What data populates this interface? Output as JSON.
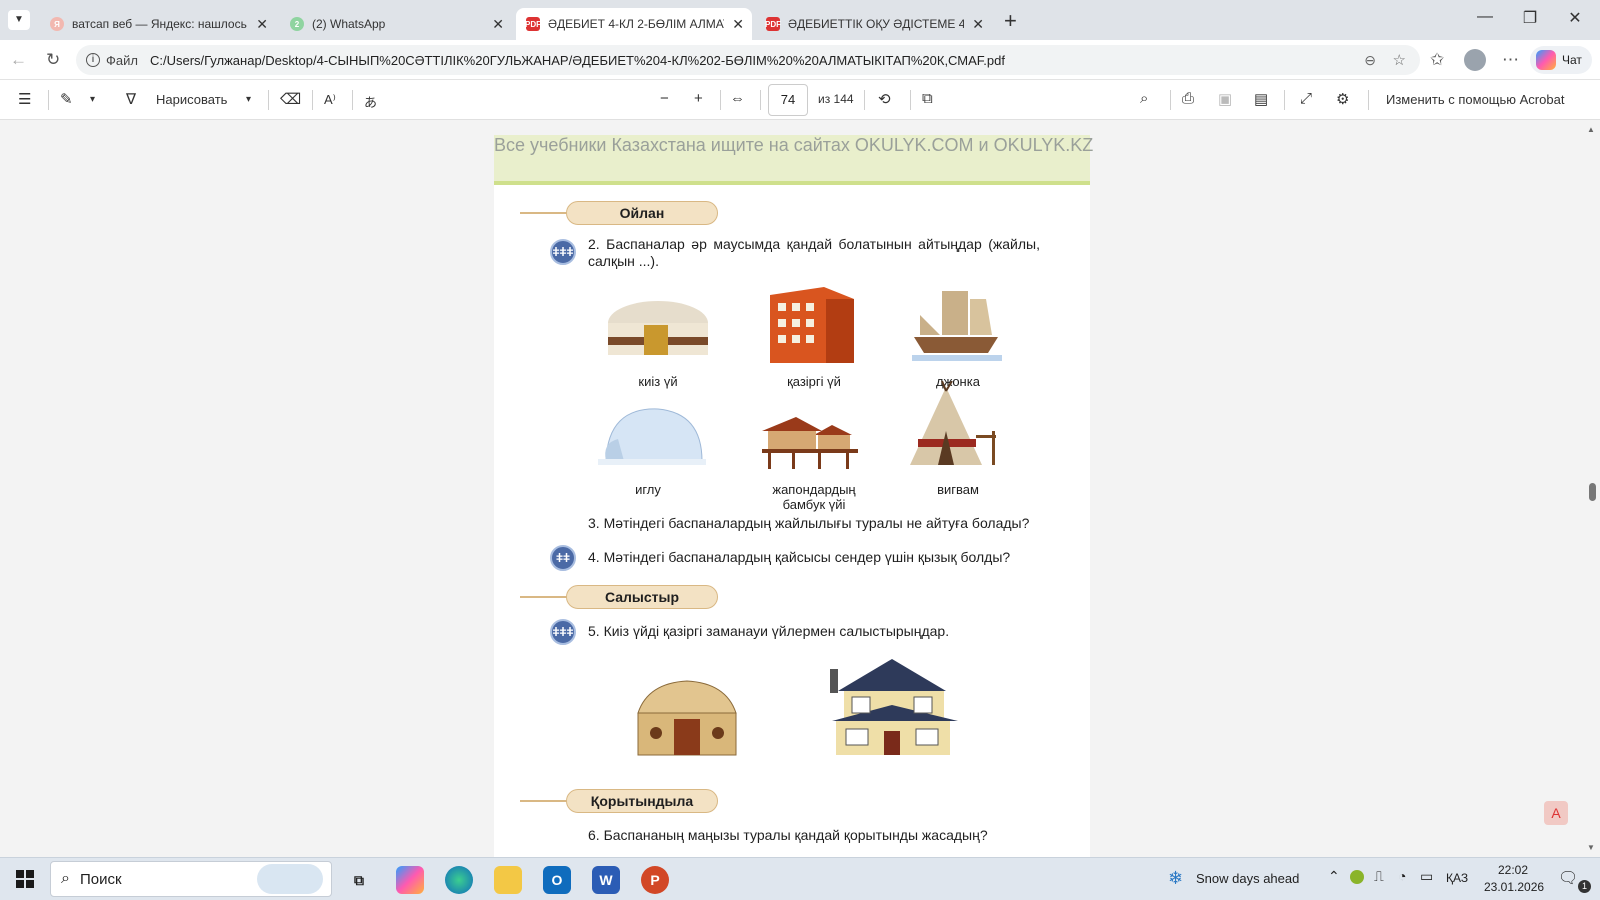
{
  "tabs": [
    {
      "label": "ватсап веб — Яндекс: нашлось 5 тыс.",
      "active": false,
      "icon": "yandex-icon",
      "color": "#f2b8b0"
    },
    {
      "label": "(2) WhatsApp",
      "active": false,
      "icon": "whatsapp-icon",
      "color": "#8fd4a0"
    },
    {
      "label": "ӘДЕБИЕТ 4-КЛ 2-БӨЛІМ АЛМАТЫКІТАП",
      "active": true,
      "icon": "pdf-icon",
      "color": "#d33"
    },
    {
      "label": "ӘДЕБИЕТТІК ОҚУ ӘДІСТЕМЕ 4-СЫНЫП",
      "active": false,
      "icon": "pdf-icon",
      "color": "#d33"
    }
  ],
  "address": {
    "label": "Файл",
    "url": "C:/Users/Гулжанар/Desktop/4-СЫНЫП%20СӘТТІЛІК%20ГУЛЬЖАНАР/ӘДЕБИЕТ%204-КЛ%202-БӨЛІМ%20%20АЛМАТЫКІТАП%20К,СМАF.pdf",
    "chat": "Чат"
  },
  "toolbar": {
    "draw": "Нарисовать",
    "page": "74",
    "of": "из 144",
    "acrobat": "Изменить с помощью Acrobat"
  },
  "page": {
    "banner": "Все учебники Казахстана ищите на сайтах OKULYK.COM и OKULYK.KZ",
    "section1": "Ойлан",
    "q2": "2. Баспаналар әр маусымда қандай болатынын айтыңдар (жайлы, салқын ...).",
    "captions": [
      "киіз үй",
      "қазіргі үй",
      "джонка",
      "иглу",
      "жапондардың бамбук үйі",
      "вигвам"
    ],
    "q3": "3. Мәтіндегі баспаналардың жайлылығы туралы не айтуға болады?",
    "q4": "4. Мәтіндегі баспаналардың қайсысы сендер үшін қызық болды?",
    "section2": "Салыстыр",
    "q5": "5. Киіз үйді қазіргі заманауи үйлермен салыстырыңдар.",
    "section3": "Қорытындыла",
    "q6": "6. Баспананың маңызы туралы қандай қорытынды жасадың?"
  },
  "taskbar": {
    "search": "Поиск",
    "weather": "Snow days ahead",
    "lang": "ҚАЗ",
    "time": "22:02",
    "date": "23.01.2026",
    "notifications": "1"
  }
}
